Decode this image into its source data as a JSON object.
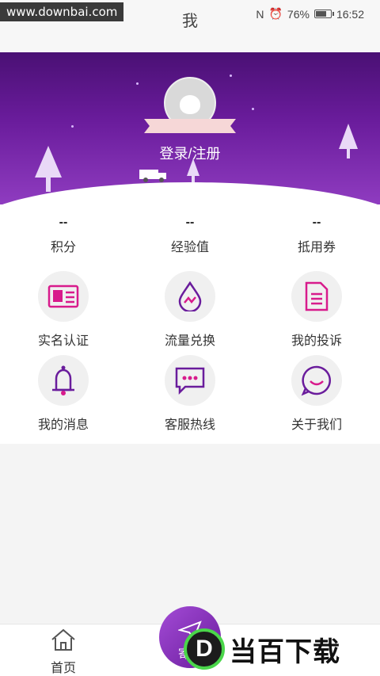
{
  "status": {
    "watermark": "www.downbai.com",
    "battery_pct": "76%",
    "battery_level": 0.76,
    "time": "16:52"
  },
  "header": {
    "title": "我"
  },
  "profile": {
    "login_label": "登录/注册"
  },
  "stats": [
    {
      "value": "--",
      "label": "积分"
    },
    {
      "value": "--",
      "label": "经验值"
    },
    {
      "value": "--",
      "label": "抵用券"
    }
  ],
  "menu": [
    {
      "label": "实名认证",
      "icon": "id-card-icon"
    },
    {
      "label": "流量兑换",
      "icon": "drop-exchange-icon"
    },
    {
      "label": "我的投诉",
      "icon": "document-icon"
    },
    {
      "label": "我的消息",
      "icon": "bell-icon"
    },
    {
      "label": "客服热线",
      "icon": "chat-bubble-icon"
    },
    {
      "label": "关于我们",
      "icon": "smile-icon"
    }
  ],
  "tabbar": {
    "home": "首页",
    "center_tab": "寄"
  },
  "brand": {
    "mark": "D",
    "text": "当百下载"
  },
  "colors": {
    "accent": "#d81b8c",
    "purple": "#6a1c9c"
  }
}
